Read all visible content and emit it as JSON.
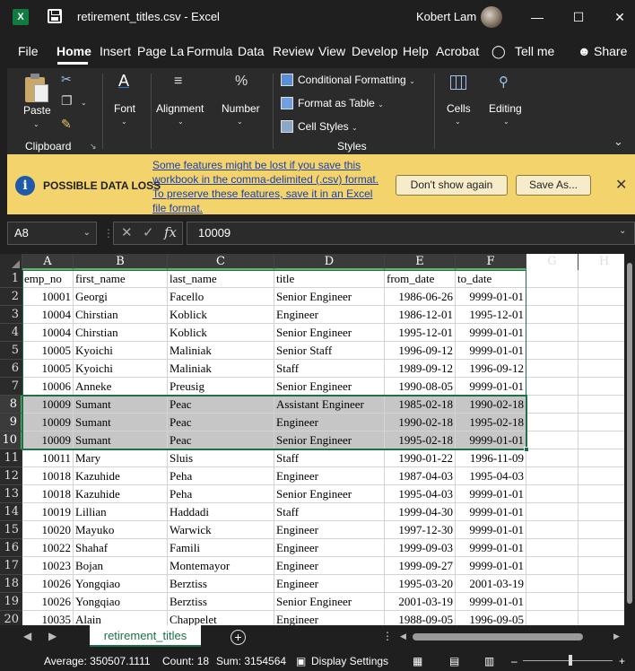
{
  "titlebar": {
    "filename": "retirement_titles.csv",
    "app": "Excel",
    "user": "Kobert Lam",
    "minimize": "—",
    "maximize": "☐",
    "close": "✕"
  },
  "menu": {
    "items": [
      "File",
      "Home",
      "Insert",
      "Page La",
      "Formula",
      "Data",
      "Review",
      "View",
      "Develop",
      "Help",
      "Acrobat"
    ],
    "active": "Home",
    "tell_me": "Tell me",
    "share": "Share"
  },
  "ribbon": {
    "paste": "Paste",
    "clipboard": "Clipboard",
    "font": "Font",
    "alignment": "Alignment",
    "number": "Number",
    "conditional_formatting": "Conditional Formatting",
    "format_as_table": "Format as Table",
    "cell_styles": "Cell Styles",
    "styles": "Styles",
    "cells": "Cells",
    "editing": "Editing"
  },
  "warning": {
    "title": "POSSIBLE DATA LOSS",
    "message": "Some features might be lost if you save this workbook in the comma-delimited (.csv) format. To preserve these features, save it in an Excel file format.",
    "dont_show": "Don't show again",
    "save_as": "Save As..."
  },
  "formula_bar": {
    "name_box": "A8",
    "formula": "10009"
  },
  "grid": {
    "columns": [
      "A",
      "B",
      "C",
      "D",
      "E",
      "F",
      "G",
      "H"
    ],
    "rows": [
      {
        "num": "1",
        "cells": [
          "emp_no",
          "first_name",
          "last_name",
          "title",
          "from_date",
          "to_date"
        ]
      },
      {
        "num": "2",
        "cells": [
          "10001",
          "Georgi",
          "Facello",
          "Senior Engineer",
          "1986-06-26",
          "9999-01-01"
        ]
      },
      {
        "num": "3",
        "cells": [
          "10004",
          "Chirstian",
          "Koblick",
          "Engineer",
          "1986-12-01",
          "1995-12-01"
        ]
      },
      {
        "num": "4",
        "cells": [
          "10004",
          "Chirstian",
          "Koblick",
          "Senior Engineer",
          "1995-12-01",
          "9999-01-01"
        ]
      },
      {
        "num": "5",
        "cells": [
          "10005",
          "Kyoichi",
          "Maliniak",
          "Senior Staff",
          "1996-09-12",
          "9999-01-01"
        ]
      },
      {
        "num": "6",
        "cells": [
          "10005",
          "Kyoichi",
          "Maliniak",
          "Staff",
          "1989-09-12",
          "1996-09-12"
        ]
      },
      {
        "num": "7",
        "cells": [
          "10006",
          "Anneke",
          "Preusig",
          "Senior Engineer",
          "1990-08-05",
          "9999-01-01"
        ]
      },
      {
        "num": "8",
        "cells": [
          "10009",
          "Sumant",
          "Peac",
          "Assistant Engineer",
          "1985-02-18",
          "1990-02-18"
        ]
      },
      {
        "num": "9",
        "cells": [
          "10009",
          "Sumant",
          "Peac",
          "Engineer",
          "1990-02-18",
          "1995-02-18"
        ]
      },
      {
        "num": "10",
        "cells": [
          "10009",
          "Sumant",
          "Peac",
          "Senior Engineer",
          "1995-02-18",
          "9999-01-01"
        ]
      },
      {
        "num": "11",
        "cells": [
          "10011",
          "Mary",
          "Sluis",
          "Staff",
          "1990-01-22",
          "1996-11-09"
        ]
      },
      {
        "num": "12",
        "cells": [
          "10018",
          "Kazuhide",
          "Peha",
          "Engineer",
          "1987-04-03",
          "1995-04-03"
        ]
      },
      {
        "num": "13",
        "cells": [
          "10018",
          "Kazuhide",
          "Peha",
          "Senior Engineer",
          "1995-04-03",
          "9999-01-01"
        ]
      },
      {
        "num": "14",
        "cells": [
          "10019",
          "Lillian",
          "Haddadi",
          "Staff",
          "1999-04-30",
          "9999-01-01"
        ]
      },
      {
        "num": "15",
        "cells": [
          "10020",
          "Mayuko",
          "Warwick",
          "Engineer",
          "1997-12-30",
          "9999-01-01"
        ]
      },
      {
        "num": "16",
        "cells": [
          "10022",
          "Shahaf",
          "Famili",
          "Engineer",
          "1999-09-03",
          "9999-01-01"
        ]
      },
      {
        "num": "17",
        "cells": [
          "10023",
          "Bojan",
          "Montemayor",
          "Engineer",
          "1999-09-27",
          "9999-01-01"
        ]
      },
      {
        "num": "18",
        "cells": [
          "10026",
          "Yongqiao",
          "Berztiss",
          "Engineer",
          "1995-03-20",
          "2001-03-19"
        ]
      },
      {
        "num": "19",
        "cells": [
          "10026",
          "Yongqiao",
          "Berztiss",
          "Senior Engineer",
          "2001-03-19",
          "9999-01-01"
        ]
      },
      {
        "num": "20",
        "cells": [
          "10035",
          "Alain",
          "Chappelet",
          "Engineer",
          "1988-09-05",
          "1996-09-05"
        ]
      }
    ],
    "selected_rows": [
      "8",
      "9",
      "10"
    ]
  },
  "sheets": {
    "active": "retirement_titles"
  },
  "status": {
    "average": "Average: 350507.1111",
    "count": "Count: 18",
    "sum": "Sum: 3154564",
    "display_settings": "Display Settings"
  },
  "colors": {
    "accent": "#1e7145",
    "warning_bg": "#f3d36b",
    "selection": "#c6c6c6"
  }
}
